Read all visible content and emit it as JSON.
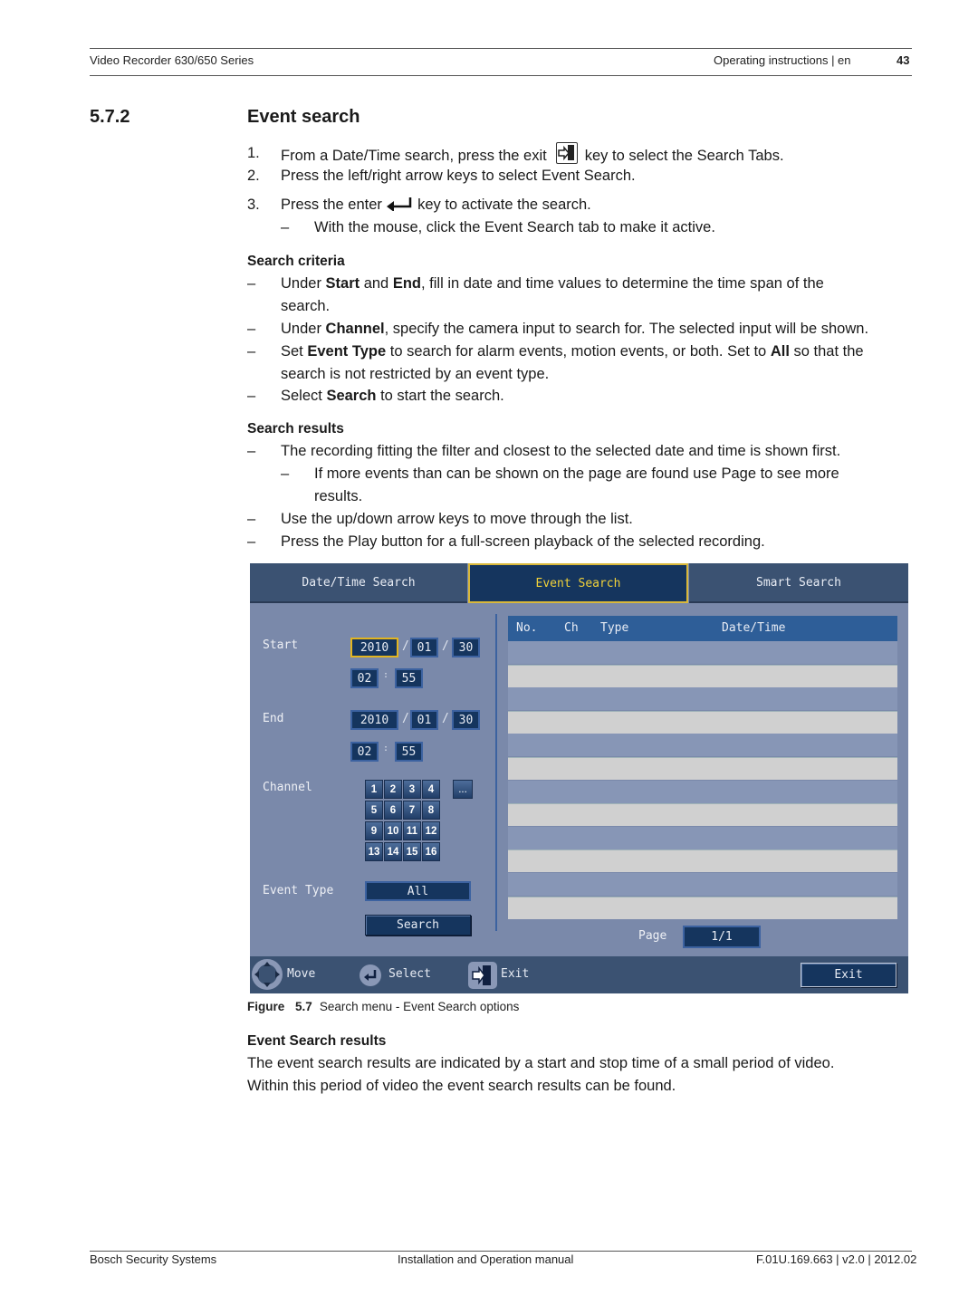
{
  "header": {
    "left": "Video Recorder 630/650 Series",
    "right": "Operating instructions | en",
    "page_number": "43"
  },
  "section": {
    "number": "5.7.2",
    "title": "Event search"
  },
  "steps": [
    {
      "num": "1.",
      "before": "From a Date/Time search, press the exit",
      "icon": "exit-key-icon",
      "after": "key to select the Search Tabs."
    },
    {
      "num": "2.",
      "text": "Press the left/right arrow keys to select Event Search."
    },
    {
      "num": "3.",
      "before": "Press the enter",
      "icon": "enter-key-icon",
      "after": "key to activate the search."
    }
  ],
  "step3_sub": "With the mouse, click the Event Search tab to make it active.",
  "search_criteria": {
    "heading": "Search criteria",
    "items": [
      {
        "parts": [
          "Under ",
          "Start",
          " and ",
          "End",
          ", fill in date and time values to determine the time span of the"
        ],
        "line2": "search."
      },
      {
        "parts": [
          "Under ",
          "Channel",
          ", specify the camera input to search for. The selected input will be shown."
        ]
      },
      {
        "parts": [
          "Set ",
          "Event Type",
          " to search for alarm events, motion events, or both. Set to ",
          "All",
          " so that the"
        ],
        "line2": "search is not restricted by an event type."
      },
      {
        "parts": [
          "Select ",
          "Search",
          " to start the search."
        ]
      }
    ]
  },
  "search_results": {
    "heading": "Search results",
    "item1": "The recording fitting the filter and closest to the selected date and time is shown first.",
    "item1_sub_line1": "If more events than can be shown on the page are found use Page to see more",
    "item1_sub_line2": "results.",
    "item2": "Use the up/down arrow keys to move through the list.",
    "item3": "Press the Play button for a full-screen playback of the selected recording."
  },
  "screen": {
    "tabs": [
      {
        "label": "Date/Time Search",
        "active": false
      },
      {
        "label": "Event Search",
        "active": true
      },
      {
        "label": "Smart Search",
        "active": false
      }
    ],
    "start": {
      "label": "Start",
      "year": "2010",
      "month": "01",
      "day": "30",
      "hour": "02",
      "minute": "55"
    },
    "end": {
      "label": "End",
      "year": "2010",
      "month": "01",
      "day": "30",
      "hour": "02",
      "minute": "55"
    },
    "date_sep": "/",
    "time_sep": ":",
    "channel": {
      "label": "Channel",
      "buttons": [
        "1",
        "2",
        "3",
        "4",
        "5",
        "6",
        "7",
        "8",
        "9",
        "10",
        "11",
        "12",
        "13",
        "14",
        "15",
        "16"
      ],
      "more": "..."
    },
    "event_type": {
      "label": "Event Type",
      "value": "All"
    },
    "search_button": "Search",
    "list": {
      "columns": [
        "No.",
        "Ch",
        "Type",
        "Date/Time"
      ],
      "rows": 12
    },
    "page": {
      "label": "Page",
      "value": "1/1"
    },
    "hints": [
      {
        "icon": "dpad-icon",
        "label": "Move"
      },
      {
        "icon": "enter-icon",
        "label": "Select"
      },
      {
        "icon": "exit-icon",
        "label": "Exit"
      }
    ],
    "exit_button": "Exit",
    "colors": {
      "panel": "#7a89aa",
      "tab": "#3b5272",
      "active_tab": "#15355e",
      "active_text": "#f2d23a",
      "focus_border": "#e2b520",
      "list_header": "#2e5e98"
    }
  },
  "figure": {
    "label": "Figure",
    "number": "5.7",
    "caption": "Search menu - Event Search options"
  },
  "event_search_results": {
    "heading": "Event Search results",
    "line1": "The event search results are indicated by a start and stop time of a small period of video.",
    "line2": "Within this period of video the event search results can be found."
  },
  "footer": {
    "left": "Bosch Security Systems",
    "center": "Installation and Operation manual",
    "right": "F.01U.169.663 | v2.0 | 2012.02"
  }
}
